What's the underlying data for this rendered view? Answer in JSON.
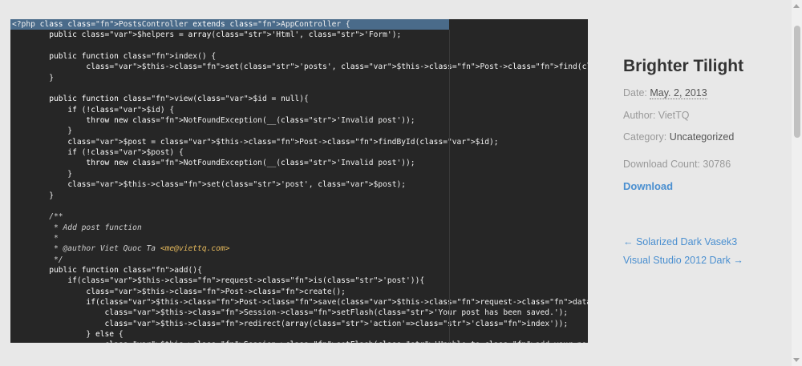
{
  "preview": {
    "lines": [
      "<?php class PostsController extends AppController {",
      "        public $helpers = array('Html', 'Form');",
      "",
      "        public function index() {",
      "                $this->set('posts', $this->Post->find('all'));",
      "        }",
      "",
      "        public function view($id = null){",
      "            if (!$id) {",
      "                throw new NotFoundException(__('Invalid post'));",
      "            }",
      "            $post = $this->Post->findById($id);",
      "            if (!$post) {",
      "                throw new NotFoundException(__('Invalid post'));",
      "            }",
      "            $this->set('post', $post);",
      "        }",
      "",
      "        /**",
      "         * Add post function",
      "         *",
      "         * @author Viet Quoc Ta <me@viettq.com>",
      "         */",
      "        public function add(){",
      "            if($this->request->is('post')){",
      "                $this->Post->create();",
      "                if($this->Post->save($this->request->data)){",
      "                    $this->Session->setFlash('Your post has been saved.');",
      "                    $this->redirect(array('action'=>'index'));",
      "                } else {",
      "                    $this->Session->setFlash('Unable to add your post.');"
    ]
  },
  "post": {
    "title": "Brighter Tilight",
    "date_label": "Date:",
    "date_value": "May. 2, 2013",
    "author_label": "Author:",
    "author_value": "VietTQ",
    "category_label": "Category:",
    "category_value": "Uncategorized",
    "download_count_label": "Download Count:",
    "download_count_value": "30786",
    "download_label": "Download"
  },
  "navigation": {
    "prev_label": "← Solarized Dark Vasek3",
    "next_label": "Visual Studio 2012 Dark →"
  },
  "colors": {
    "link": "#4a8fd0",
    "editor_bg": "#262626",
    "selection": "#4a6b8a"
  }
}
